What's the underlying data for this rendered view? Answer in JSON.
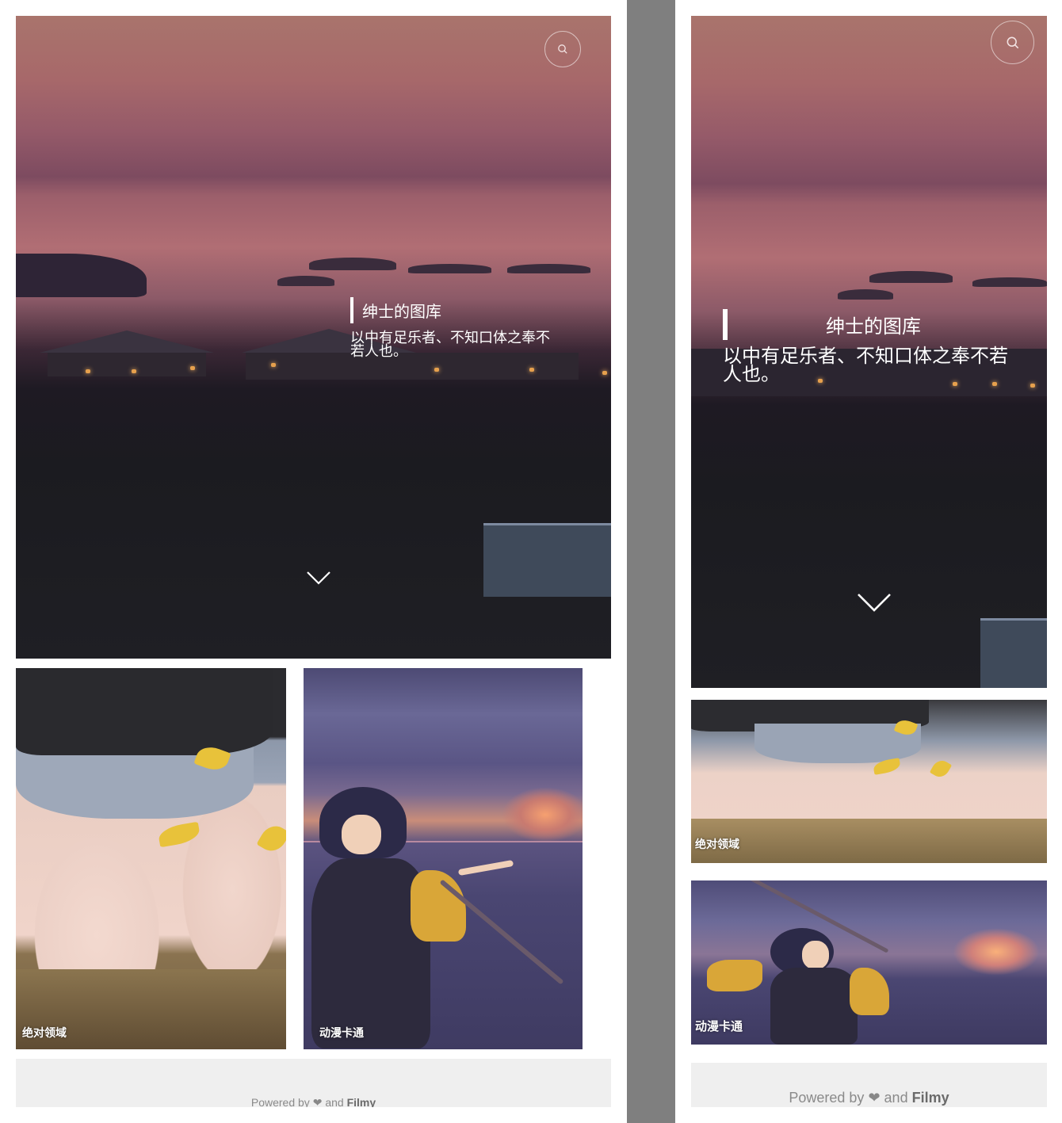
{
  "site": {
    "title": "绅士的图库",
    "motto": "以中有足乐者、不知口体之奉不若人也。"
  },
  "icons": {
    "search": "search-icon",
    "scroll_down": "chevron-down-icon",
    "heart": "heart-icon"
  },
  "cards": [
    {
      "label": "绝对领域"
    },
    {
      "label": "动漫卡通"
    }
  ],
  "footer": {
    "powered_by": "Powered by",
    "and": "and",
    "brand": "Filmy"
  },
  "colors": {
    "divider": "#7f7f7f",
    "footer_bg": "#efefef",
    "footer_text": "#8a8a8a"
  }
}
